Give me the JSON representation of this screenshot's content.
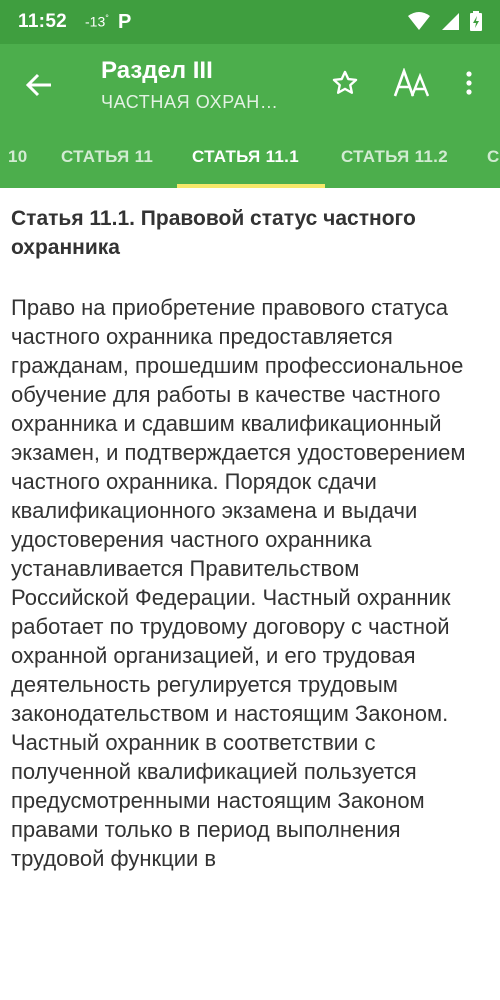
{
  "status_bar": {
    "time": "11:52",
    "temperature": "-13",
    "degree": "°",
    "app_badge": "P"
  },
  "app_bar": {
    "title": "Раздел III",
    "subtitle": "ЧАСТНАЯ ОХРАН…",
    "font_button_label": "AA"
  },
  "tabs": [
    {
      "label": "10"
    },
    {
      "label": "СТАТЬЯ 11"
    },
    {
      "label": "СТАТЬЯ 11.1",
      "active": true
    },
    {
      "label": "СТАТЬЯ 11.2"
    },
    {
      "label": "С"
    }
  ],
  "article": {
    "title": "Статья 11.1. Правовой статус частного охранника",
    "body": "Право на приобретение правового статуса частного охранника предоставляется гражданам, прошедшим профессиональное обучение для работы в качестве частного охранника и сдавшим квалификационный экзамен, и подтверждается удостоверением частного охранника. Порядок сдачи квалификационного экзамена и выдачи удостоверения частного охранника устанавливается Правительством Российской Федерации. Частный охранник работает по трудовому договору с частной охранной организацией, и его трудовая деятельность регулируется трудовым законодательством и настоящим Законом. Частный охранник в соответствии с полученной квалификацией пользуется предусмотренными настоящим Законом правами только в период выполнения трудовой функции в"
  },
  "colors": {
    "status_bar": "#3f9e3f",
    "app_bar": "#4cae4c",
    "tab_indicator": "#f6e86a"
  },
  "icons": [
    "arrow-back-icon",
    "star-outline-icon",
    "font-size-icon",
    "more-vert-icon",
    "wifi-icon",
    "signal-icon",
    "battery-icon"
  ]
}
